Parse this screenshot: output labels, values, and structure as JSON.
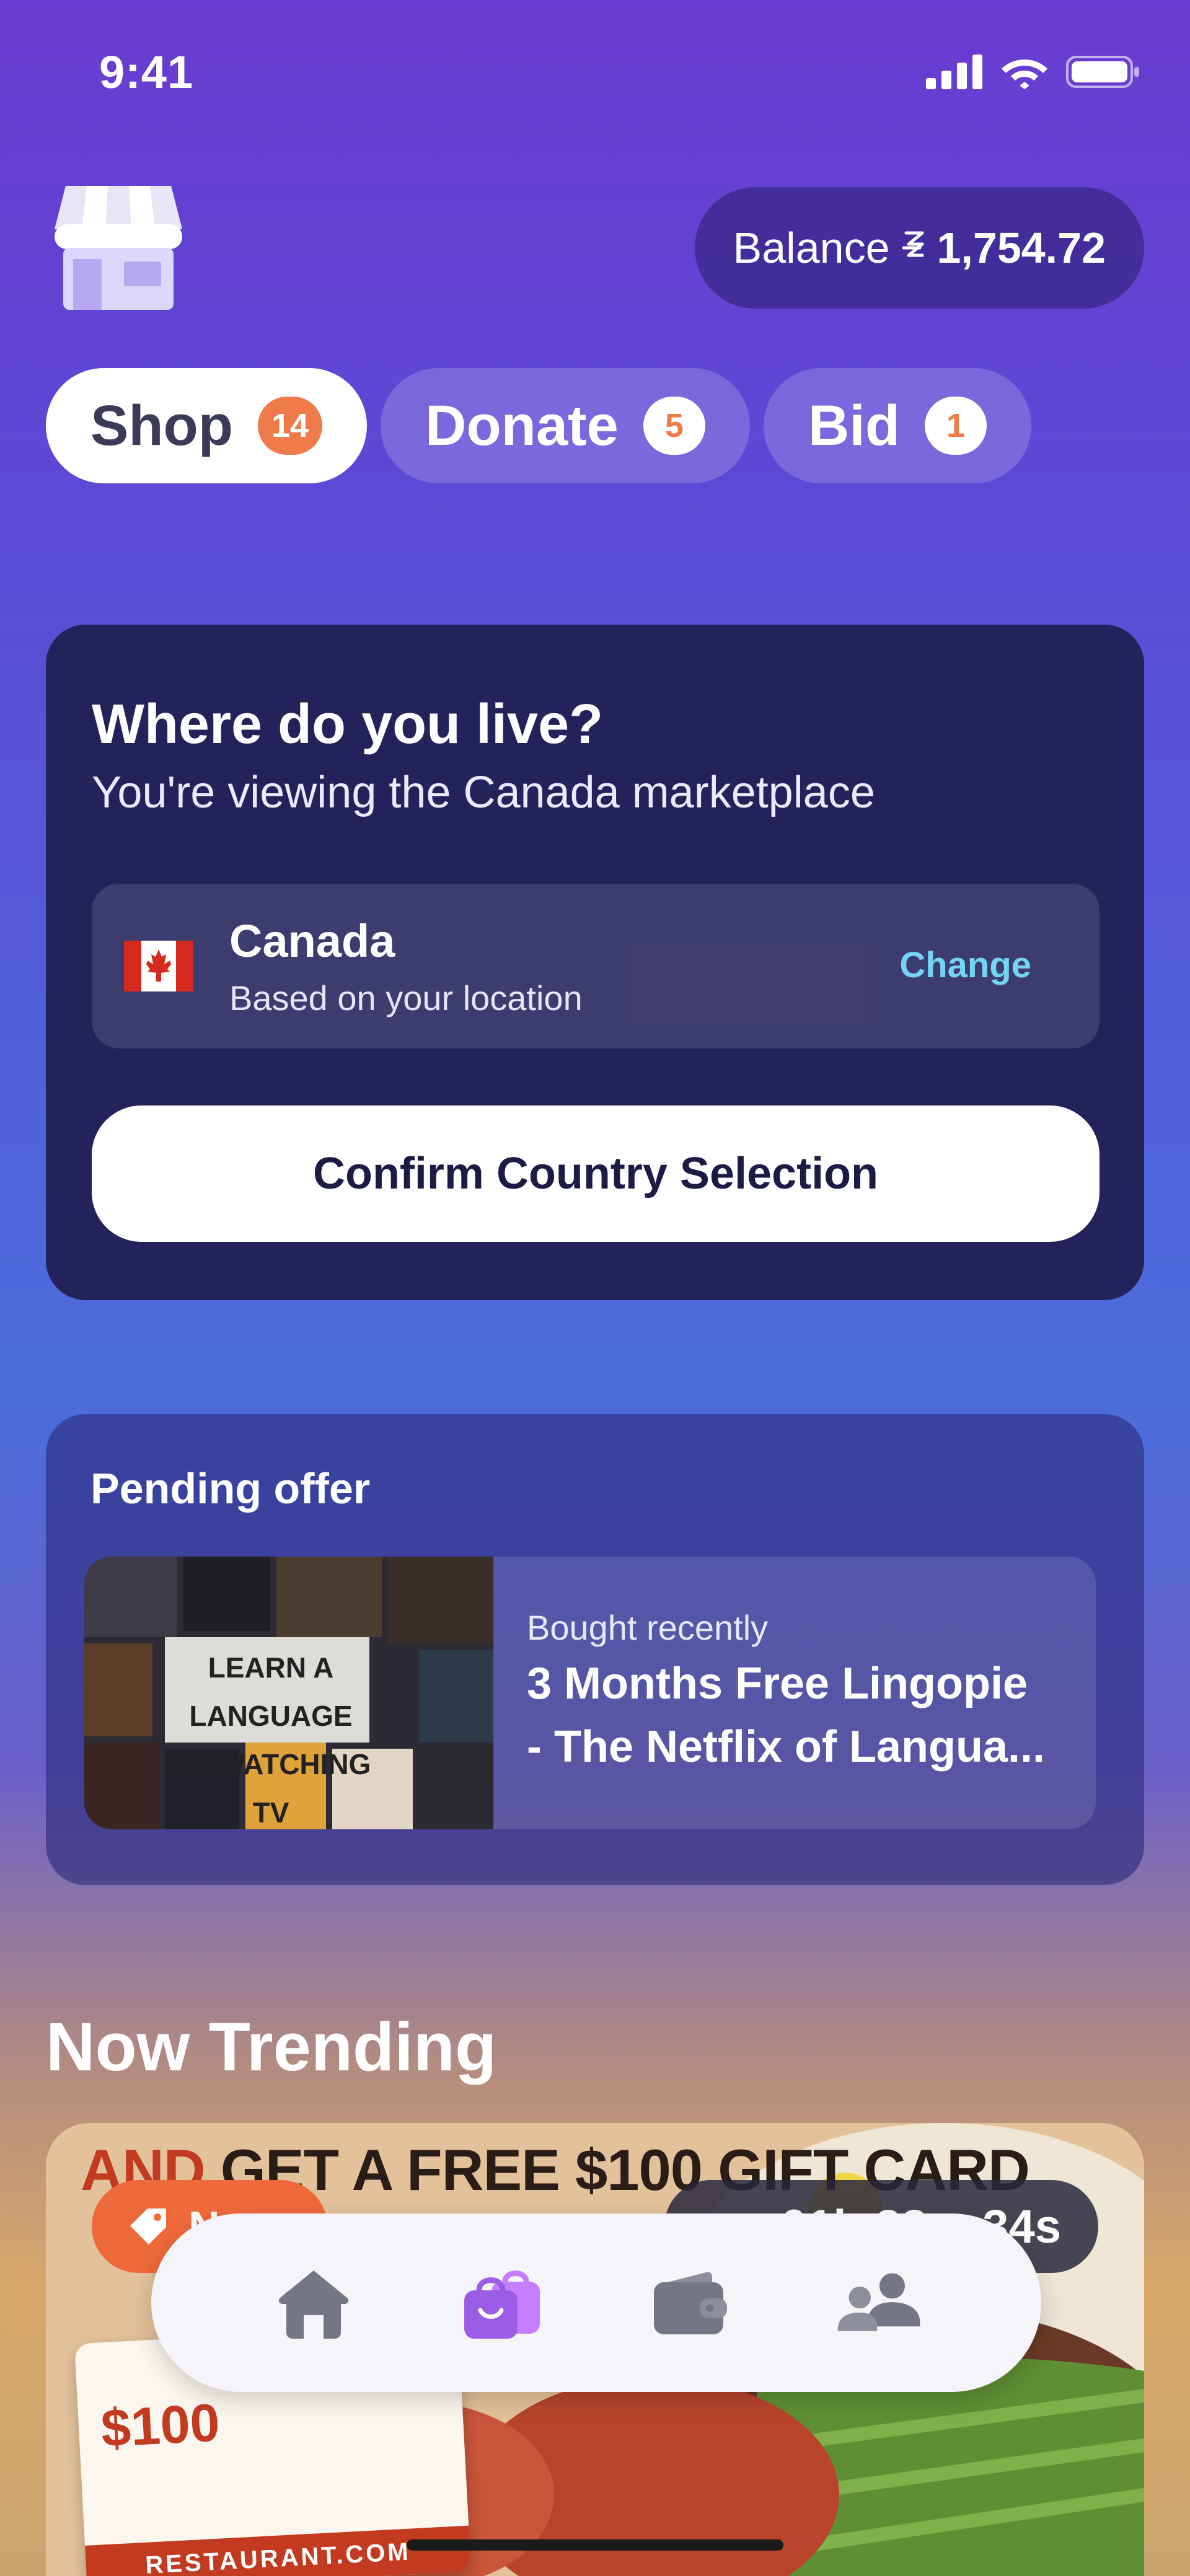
{
  "status_bar": {
    "time": "9:41"
  },
  "header": {
    "balance_label": "Balance",
    "balance_amount": "1,754.72"
  },
  "tabs": [
    {
      "label": "Shop",
      "badge": "14",
      "active": true
    },
    {
      "label": "Donate",
      "badge": "5",
      "active": false
    },
    {
      "label": "Bid",
      "badge": "1",
      "active": false
    }
  ],
  "country_card": {
    "title": "Where do you live?",
    "subtitle": "You're viewing the Canada marketplace",
    "country": "Canada",
    "country_note": "Based on your location",
    "change_label": "Change",
    "confirm_label": "Confirm Country Selection"
  },
  "pending_offer": {
    "title": "Pending offer",
    "kicker": "Bought recently",
    "offer_title_line1": "3 Months Free Lingopie",
    "offer_title_line2": "- The Netflix of Langua...",
    "thumb_text_line1": "LEARN A LANGUAGE",
    "thumb_text_line2": "BY WATCHING TV"
  },
  "trending": {
    "heading": "Now Trending",
    "headline_part1": "AND",
    "headline_part2": " GET A FREE $100 GIFT CARD",
    "tag_label": "N",
    "timer": "01h 33m 34s",
    "giftcard_value": "$100",
    "giftcard_brand": "RESTAURANT.COM"
  },
  "tabbar": {
    "items": [
      "home-icon",
      "shopping-bags-icon",
      "wallet-icon",
      "people-icon"
    ],
    "active_color": "#9b5de5"
  },
  "colors": {
    "badge": "#ef7a4a",
    "card_dark": "#23225a",
    "link": "#74d4f4"
  }
}
